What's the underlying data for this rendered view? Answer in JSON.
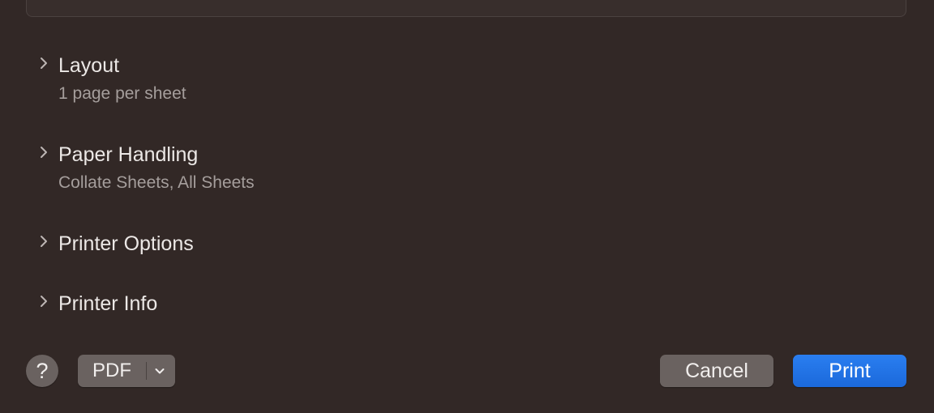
{
  "sections": [
    {
      "title": "Layout",
      "subtitle": "1 page per sheet"
    },
    {
      "title": "Paper Handling",
      "subtitle": "Collate Sheets, All Sheets"
    },
    {
      "title": "Printer Options",
      "subtitle": ""
    },
    {
      "title": "Printer Info",
      "subtitle": ""
    }
  ],
  "footer": {
    "help_label": "?",
    "pdf_label": "PDF",
    "cancel_label": "Cancel",
    "print_label": "Print"
  },
  "icons": {
    "disclosure": "chevron-right-icon",
    "pdf_menu": "chevron-down-icon"
  },
  "colors": {
    "background": "#322826",
    "accent": "#1f6fe0",
    "button": "#6a6260",
    "subtitle_text": "#a59e9c"
  }
}
